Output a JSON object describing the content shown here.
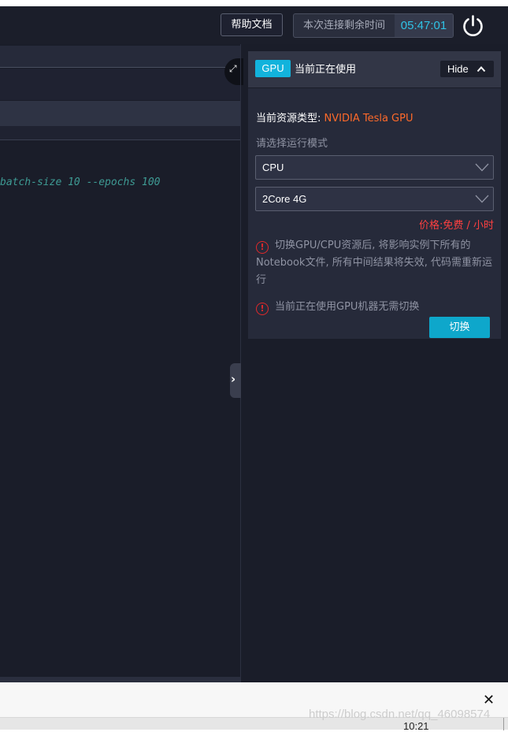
{
  "header": {
    "help_label": "帮助文档",
    "timer_label": "本次连接剩余时间",
    "timer_value": "05:47:01"
  },
  "editor": {
    "code_text": "batch-size 10 --epochs 100"
  },
  "panel": {
    "badge": "GPU",
    "title": "当前正在使用",
    "hide_label": "Hide",
    "resource_label": "当前资源类型:",
    "resource_value": " NVIDIA Tesla GPU",
    "mode_label": "请选择运行模式",
    "mode_select": "CPU",
    "spec_select": "2Core 4G",
    "price": "价格:免费 / 小时",
    "warning1": "切换GPU/CPU资源后, 将影响实例下所有的Notebook文件, 所有中间结果将失效, 代码需重新运行",
    "warning2": "当前正在使用GPU机器无需切换",
    "switch_label": "切换"
  },
  "footer": {
    "close": "✕",
    "clock": "10:21",
    "watermark": "https://blog.csdn.net/qq_46098574"
  },
  "colors": {
    "accent": "#12b3dc",
    "timer": "#2fc3e6",
    "resource_value": "#ff6a2a",
    "price": "#ff4040",
    "warning_icon": "#e0292b"
  }
}
